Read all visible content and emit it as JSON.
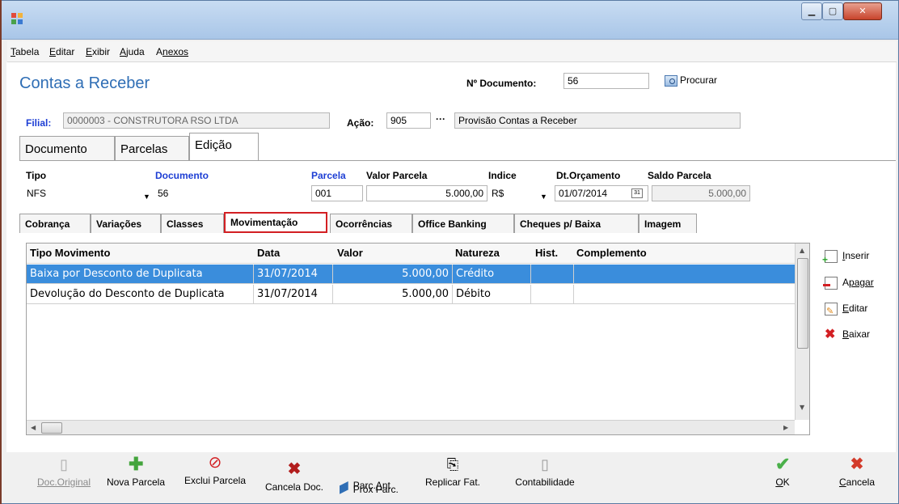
{
  "menu": [
    {
      "u": "T",
      "rest": "abela"
    },
    {
      "u": "E",
      "rest": "ditar"
    },
    {
      "u": "E",
      "rest": "xibir"
    },
    {
      "u": "A",
      "rest": "juda"
    },
    {
      "u": "A",
      "rest": "nexos"
    }
  ],
  "header": {
    "title": "Contas a Receber",
    "num_doc_label": "Nº Documento:",
    "num_doc_value": "56",
    "procurar": "Procurar",
    "filial_label": "Filial:",
    "filial_value": "0000003 - CONSTRUTORA RSO LTDA",
    "acao_label": "Ação:",
    "acao_value": "905",
    "acao_desc": "Provisão Contas a Receber",
    "ellipsis": "···"
  },
  "main_tabs": [
    "Documento",
    "Parcelas",
    "Edição"
  ],
  "fields": {
    "tipo_label": "Tipo",
    "tipo_value": "NFS",
    "documento_label": "Documento",
    "documento_value": "56",
    "parcela_label": "Parcela",
    "parcela_value": "001",
    "valor_label": "Valor Parcela",
    "valor_value": "5.000,00",
    "indice_label": "Indice",
    "indice_value": "R$",
    "dtorc_label": "Dt.Orçamento",
    "dtorc_value": "01/07/2014",
    "saldo_label": "Saldo Parcela",
    "saldo_value": "5.000,00"
  },
  "sub_tabs": [
    "Cobrança",
    "Variações",
    "Classes",
    "Movimentação",
    "Ocorrências",
    "Office Banking",
    "Cheques p/ Baixa",
    "Imagem"
  ],
  "grid": {
    "headers": [
      "Tipo Movimento",
      "Data",
      "Valor",
      "Natureza",
      "Hist.",
      "Complemento"
    ],
    "rows": [
      {
        "tipo": "Baixa por Desconto de Duplicata",
        "data": "31/07/2014",
        "valor": "5.000,00",
        "natureza": "Crédito",
        "hist": "",
        "comp": ""
      },
      {
        "tipo": "Devolução do Desconto de Duplicata",
        "data": "31/07/2014",
        "valor": "5.000,00",
        "natureza": "Débito",
        "hist": "",
        "comp": ""
      }
    ]
  },
  "side_actions": [
    {
      "u": "I",
      "rest": "nserir"
    },
    {
      "u": "A",
      "rest": "pagar"
    },
    {
      "u": "E",
      "rest": "ditar"
    },
    {
      "u": "B",
      "rest": "aixar"
    }
  ],
  "footer": {
    "doc_original": "Doc.Original",
    "nova_parcela": "Nova Parcela",
    "exclui_parcela": "Exclui Parcela",
    "cancela_doc": "Cancela Doc.",
    "parc_ant_a": "Parc.",
    "parc_ant_u": "A",
    "parc_ant_b": "nt",
    "prox_parc": "Próx Parc.",
    "replicar": "Replicar Fat.",
    "contabilidade": "Contabilidade",
    "ok_u": "O",
    "ok_rest": "K",
    "cancela_u": "C",
    "cancela_rest": "ancela"
  },
  "colors": {
    "accent": "#2f6eb5",
    "selection": "#3a8ddc",
    "highlight": "#d31f23",
    "field_blue": "#1d3ed4"
  }
}
